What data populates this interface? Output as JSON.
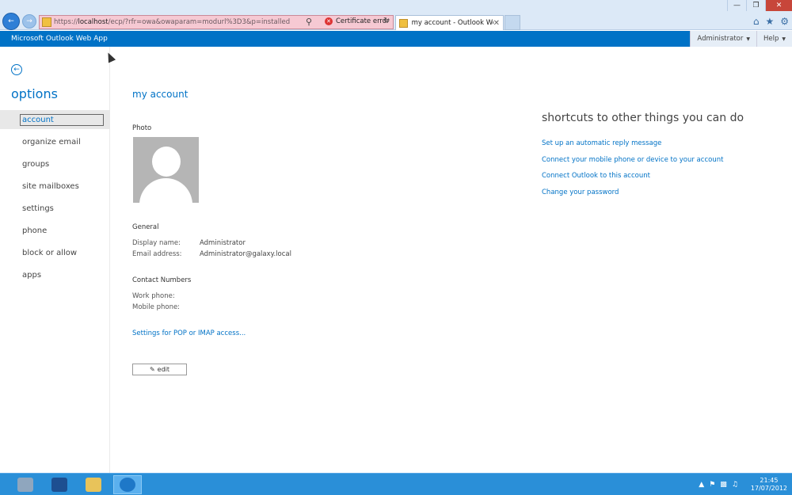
{
  "browser": {
    "url_prefix": "https://",
    "url_host": "localhost",
    "url_path": "/ecp/?rfr=owa&owaparam=modurl%3D3&p=installed",
    "cert_error": "Certificate error",
    "tab_title": "my account - Outlook Web...",
    "search_icon": "magnifier-icon",
    "refresh_icon": "refresh-icon"
  },
  "owa": {
    "app_title": "Microsoft Outlook Web App",
    "user_menu": "Administrator",
    "help_menu": "Help"
  },
  "nav": {
    "title": "options",
    "items": [
      {
        "label": "account",
        "selected": true
      },
      {
        "label": "organize email"
      },
      {
        "label": "groups"
      },
      {
        "label": "site mailboxes"
      },
      {
        "label": "settings"
      },
      {
        "label": "phone"
      },
      {
        "label": "block or allow"
      },
      {
        "label": "apps"
      }
    ]
  },
  "main": {
    "title": "my account",
    "photo_label": "Photo",
    "general_label": "General",
    "display_name_label": "Display name:",
    "display_name_value": "Administrator",
    "email_label": "Email address:",
    "email_value": "Administrator@galaxy.local",
    "contact_label": "Contact Numbers",
    "work_phone_label": "Work phone:",
    "mobile_phone_label": "Mobile phone:",
    "pop_imap_link": "Settings for POP or IMAP access...",
    "edit_button": "edit"
  },
  "shortcuts": {
    "title": "shortcuts to other things you can do",
    "links": [
      "Set up an automatic reply message",
      "Connect your mobile phone or device to your account",
      "Connect Outlook to this account",
      "Change your password"
    ]
  },
  "taskbar": {
    "time": "21:45",
    "date": "17/07/2012"
  },
  "colors": {
    "accent": "#0072c6",
    "taskbar": "#2a8fd8"
  }
}
